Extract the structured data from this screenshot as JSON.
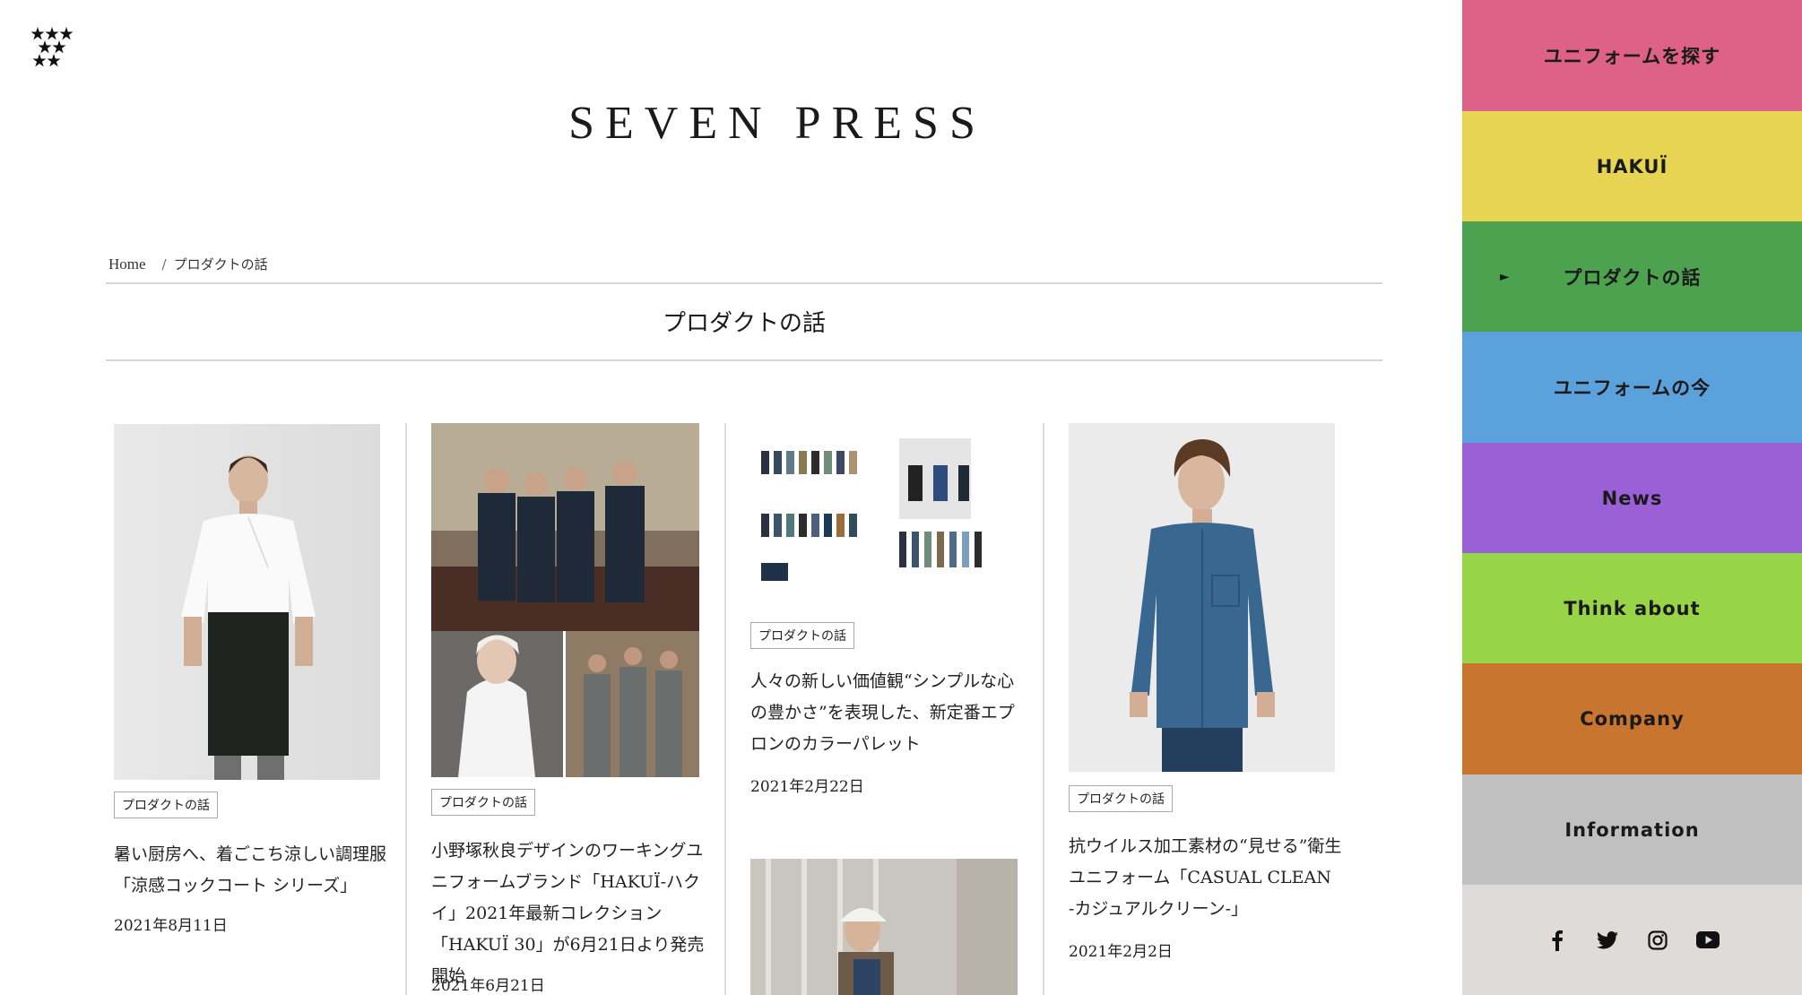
{
  "site": {
    "title": "SEVEN PRESS"
  },
  "breadcrumb": {
    "home": "Home",
    "separator": "/",
    "current": "プロダクトの話"
  },
  "section": {
    "title": "プロダクトの話"
  },
  "articles": [
    {
      "tag": "プロダクトの話",
      "title": "暑い厨房へ、着ごこち涼しい調理服「涼感コックコート シリーズ」",
      "date": "2021年8月11日"
    },
    {
      "tag": "プロダクトの話",
      "title": "小野塚秋良デザインのワーキングユニフォームブランド「HAKUÏ-ハクイ」2021年最新コレクション「HAKUÏ 30」が6月21日より発売開始",
      "date": "2021年6月21日"
    },
    {
      "tag": "プロダクトの話",
      "title": "人々の新しい価値観“シンプルな心の豊かさ”を表現した、新定番エプロンのカラーパレット",
      "date": "2021年2月22日"
    },
    {
      "tag": "プロダクトの話",
      "title": "抗ウイルス加工素材の“見せる”衛生ユニフォーム「CASUAL CLEAN -カジュアルクリーン-」",
      "date": "2021年2月2日"
    }
  ],
  "sidebar": {
    "items": [
      {
        "label": "ユニフォームを探す",
        "color": "#de6189"
      },
      {
        "label": "HAKUÏ",
        "color": "#e6d452"
      },
      {
        "label": "プロダクトの話",
        "color": "#4ca24e",
        "active": true,
        "marker": "►"
      },
      {
        "label": "ユニフォームの今",
        "color": "#5ba2dd"
      },
      {
        "label": "News",
        "color": "#9a60d6"
      },
      {
        "label": "Think about",
        "color": "#98d447"
      },
      {
        "label": "Company",
        "color": "#c8752f"
      },
      {
        "label": "Information",
        "color": "#c1c0c0"
      }
    ],
    "social": [
      "facebook-icon",
      "twitter-icon",
      "instagram-icon",
      "youtube-icon"
    ],
    "social_bg": "#dedbd8"
  }
}
